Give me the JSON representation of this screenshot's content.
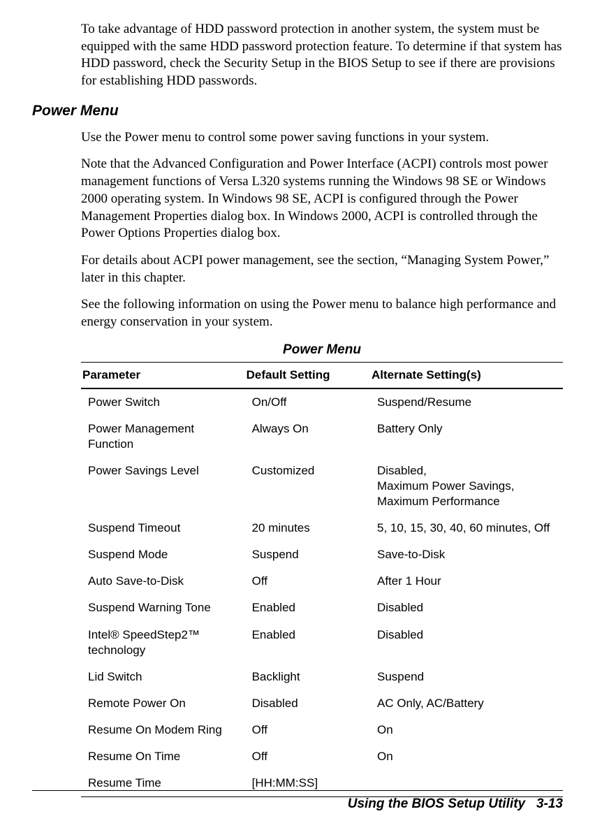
{
  "intro_para": "To take advantage of HDD password protection in another system, the system must be equipped with the same HDD password protection feature. To determine if that system has HDD password, check the Security Setup in the BIOS Setup to see if there are provisions for establishing HDD passwords.",
  "section_heading": "Power Menu",
  "para1": "Use the Power menu to control some power saving functions in your system.",
  "para2": "Note that the Advanced Configuration and Power Interface (ACPI) controls most power management functions of Versa L320 systems running the Windows 98 SE or Windows 2000 operating system. In Windows 98 SE, ACPI is configured through the Power Management Properties dialog box. In Windows 2000, ACPI is controlled through the Power Options Properties dialog box.",
  "para3": "For details about ACPI power management, see the section, “Managing System Power,” later in this chapter.",
  "para4": "See the following information on using the Power menu to balance high performance and energy conservation in your system.",
  "table_title": "Power Menu",
  "table": {
    "headers": [
      "Parameter",
      "Default Setting",
      "Alternate Setting(s)"
    ],
    "rows": [
      [
        "Power Switch",
        "On/Off",
        "Suspend/Resume"
      ],
      [
        "Power Management Function",
        "Always On",
        "Battery Only"
      ],
      [
        "Power Savings Level",
        "Customized",
        "Disabled,\nMaximum Power Savings,\nMaximum Performance"
      ],
      [
        "Suspend Timeout",
        "20 minutes",
        "5, 10, 15, 30, 40, 60 minutes, Off"
      ],
      [
        "Suspend Mode",
        "Suspend",
        "Save-to-Disk"
      ],
      [
        "Auto Save-to-Disk",
        "Off",
        "After 1 Hour"
      ],
      [
        "Suspend Warning Tone",
        "Enabled",
        "Disabled"
      ],
      [
        "Intel® SpeedStep2™ technology",
        "Enabled",
        "Disabled"
      ],
      [
        "Lid Switch",
        "Backlight",
        "Suspend"
      ],
      [
        "Remote Power On",
        "Disabled",
        "AC Only, AC/Battery"
      ],
      [
        "Resume On Modem Ring",
        "Off",
        "On"
      ],
      [
        "Resume On Time",
        "Off",
        "On"
      ],
      [
        "Resume Time",
        "[HH:MM:SS]",
        ""
      ]
    ]
  },
  "footer": "Using the BIOS Setup Utility   3-13"
}
